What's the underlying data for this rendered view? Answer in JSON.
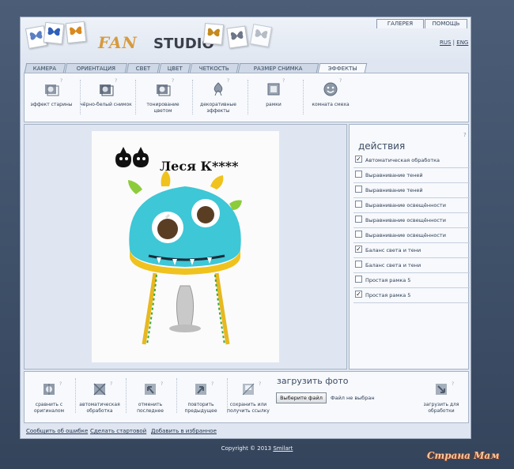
{
  "header": {
    "logo_main": "FAN",
    "logo_sub": "STUDIO",
    "nav": [
      "ГАЛЕРЕЯ",
      "ПОМОЩЬ"
    ],
    "lang": {
      "rus": "RUS",
      "sep": "|",
      "eng": "ENG"
    }
  },
  "tabs": [
    {
      "label": "КАМЕРА"
    },
    {
      "label": "ОРИЕНТАЦИЯ"
    },
    {
      "label": "СВЕТ"
    },
    {
      "label": "ЦВЕТ"
    },
    {
      "label": "ЧЕТКОСТЬ"
    },
    {
      "label": "РАЗМЕР СНИМКА"
    },
    {
      "label": "ЭФФЕКТЫ"
    }
  ],
  "effects": [
    {
      "label": "эффект старины",
      "icon": "old-photo-icon"
    },
    {
      "label": "чёрно-белый снимок",
      "icon": "black-white-icon"
    },
    {
      "label": "тонирование цветом",
      "icon": "color-tone-icon"
    },
    {
      "label": "декоративные эффекты",
      "icon": "decor-icon"
    },
    {
      "label": "рамки",
      "icon": "frames-icon"
    },
    {
      "label": "комната смеха",
      "icon": "funhouse-icon"
    }
  ],
  "help_mark": "?",
  "photo": {
    "caption": "Леся К****"
  },
  "actions": {
    "title": "действия",
    "items": [
      {
        "label": "Автоматическая обработка",
        "checked": true
      },
      {
        "label": "Выравнивание теней",
        "checked": false
      },
      {
        "label": "Выравнивание теней",
        "checked": false
      },
      {
        "label": "Выравнивание освещённости",
        "checked": false
      },
      {
        "label": "Выравнивание освещённости",
        "checked": false
      },
      {
        "label": "Выравнивание освещённости",
        "checked": false
      },
      {
        "label": "Баланс света и тени",
        "checked": true
      },
      {
        "label": "Баланс света и тени",
        "checked": false
      },
      {
        "label": "Простая рамка 5",
        "checked": false
      },
      {
        "label": "Простая рамка 5",
        "checked": true
      }
    ]
  },
  "toolbar": {
    "compare": "сравнить с оригиналом",
    "auto": "автоматическая обработка",
    "undo": "отменить последнее",
    "redo": "повторить предыдущее",
    "save": "сохранить или получить ссылку",
    "upload_title": "загрузить фото",
    "file_button": "Выберите файл",
    "file_status": "Файл не выбран",
    "upload": "загрузить для обработки"
  },
  "footer": {
    "report": "Сообщить об ошибке",
    "homepage": "Сделать стартовой",
    "favorites": "Добавить в избранное",
    "copyright_prefix": "Copyright © 2013 ",
    "copyright_link": "Smilart"
  },
  "watermark": "Страна Мам"
}
